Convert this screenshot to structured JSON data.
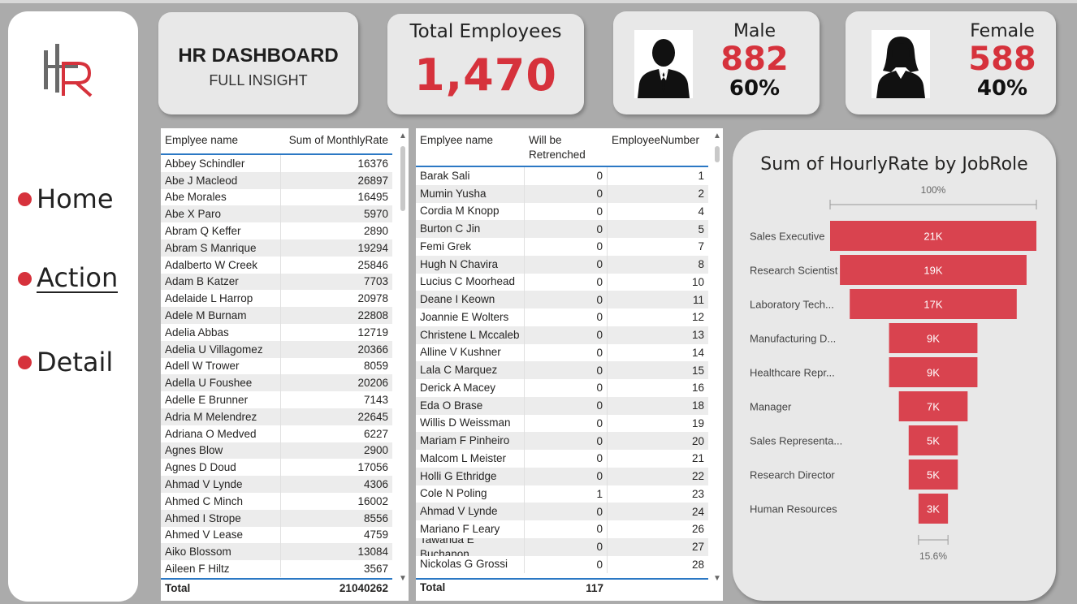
{
  "sidebar": {
    "logo_text": "HR",
    "nav": [
      {
        "label": "Home"
      },
      {
        "label": "Action"
      },
      {
        "label": "Detail"
      }
    ]
  },
  "header": {
    "title": "HR DASHBOARD",
    "subtitle": "FULL INSIGHT"
  },
  "kpi": {
    "total_label": "Total Employees",
    "total_value": "1,470",
    "male": {
      "label": "Male",
      "value": "882",
      "pct": "60%"
    },
    "female": {
      "label": "Female",
      "value": "588",
      "pct": "40%"
    }
  },
  "colors": {
    "accent": "#d6323c",
    "table_rule": "#2b78c4",
    "background": "#ababab"
  },
  "table1": {
    "headers": [
      "Emplyee name",
      "Sum of MonthlyRate"
    ],
    "rows": [
      [
        "Abbey Schindler",
        "16376"
      ],
      [
        "Abe J Macleod",
        "26897"
      ],
      [
        "Abe Morales",
        "16495"
      ],
      [
        "Abe X Paro",
        "5970"
      ],
      [
        "Abram Q Keffer",
        "2890"
      ],
      [
        "Abram S Manrique",
        "19294"
      ],
      [
        "Adalberto W Creek",
        "25846"
      ],
      [
        "Adam B Katzer",
        "7703"
      ],
      [
        "Adelaide L Harrop",
        "20978"
      ],
      [
        "Adele M Burnam",
        "22808"
      ],
      [
        "Adelia Abbas",
        "12719"
      ],
      [
        "Adelia U Villagomez",
        "20366"
      ],
      [
        "Adell W Trower",
        "8059"
      ],
      [
        "Adella U Foushee",
        "20206"
      ],
      [
        "Adelle E Brunner",
        "7143"
      ],
      [
        "Adria M Melendrez",
        "22645"
      ],
      [
        "Adriana O Medved",
        "6227"
      ],
      [
        "Agnes Blow",
        "2900"
      ],
      [
        "Agnes D Doud",
        "17056"
      ],
      [
        "Ahmad V Lynde",
        "4306"
      ],
      [
        "Ahmed C Minch",
        "16002"
      ],
      [
        "Ahmed I Strope",
        "8556"
      ],
      [
        "Ahmed V Lease",
        "4759"
      ],
      [
        "Aiko Blossom",
        "13084"
      ],
      [
        "Aileen F Hiltz",
        "3567"
      ]
    ],
    "total_label": "Total",
    "total_value": "21040262"
  },
  "table2": {
    "headers": [
      "Emplyee name",
      "Will be Retrenched",
      "EmployeeNumber"
    ],
    "rows": [
      [
        "Barak Sali",
        "0",
        "1"
      ],
      [
        "Mumin Yusha",
        "0",
        "2"
      ],
      [
        "Cordia M Knopp",
        "0",
        "4"
      ],
      [
        "Burton C Jin",
        "0",
        "5"
      ],
      [
        "Femi Grek",
        "0",
        "7"
      ],
      [
        "Hugh N Chavira",
        "0",
        "8"
      ],
      [
        "Lucius C Moorhead",
        "0",
        "10"
      ],
      [
        "Deane I Keown",
        "0",
        "11"
      ],
      [
        "Joannie E Wolters",
        "0",
        "12"
      ],
      [
        "Christene L Mccaleb",
        "0",
        "13"
      ],
      [
        "Alline V Kushner",
        "0",
        "14"
      ],
      [
        "Lala C Marquez",
        "0",
        "15"
      ],
      [
        "Derick A Macey",
        "0",
        "16"
      ],
      [
        "Eda O Brase",
        "0",
        "18"
      ],
      [
        "Willis D Weissman",
        "0",
        "19"
      ],
      [
        "Mariam F Pinheiro",
        "0",
        "20"
      ],
      [
        "Malcom L Meister",
        "0",
        "21"
      ],
      [
        "Holli G Ethridge",
        "0",
        "22"
      ],
      [
        "Cole N Poling",
        "1",
        "23"
      ],
      [
        "Ahmad V Lynde",
        "0",
        "24"
      ],
      [
        "Mariano F Leary",
        "0",
        "26"
      ],
      [
        "Tawanda E Buchanon",
        "0",
        "27"
      ],
      [
        "Nickolas G Grossi",
        "0",
        "28"
      ]
    ],
    "total_label": "Total",
    "total_value": "117"
  },
  "chart_data": {
    "type": "funnel",
    "title": "Sum of HourlyRate by JobRole",
    "top_label": "100%",
    "bottom_label": "15.6%",
    "categories": [
      "Sales Executive",
      "Research Scientist",
      "Laboratory Tech...",
      "Manufacturing D...",
      "Healthcare Repr...",
      "Manager",
      "Sales Representa...",
      "Research Director",
      "Human Resources"
    ],
    "values": [
      21,
      19,
      17,
      9,
      9,
      7,
      5,
      5,
      3
    ],
    "value_labels": [
      "21K",
      "19K",
      "17K",
      "9K",
      "9K",
      "7K",
      "5K",
      "5K",
      "3K"
    ],
    "unit": "K",
    "bar_color": "#d9434f"
  }
}
